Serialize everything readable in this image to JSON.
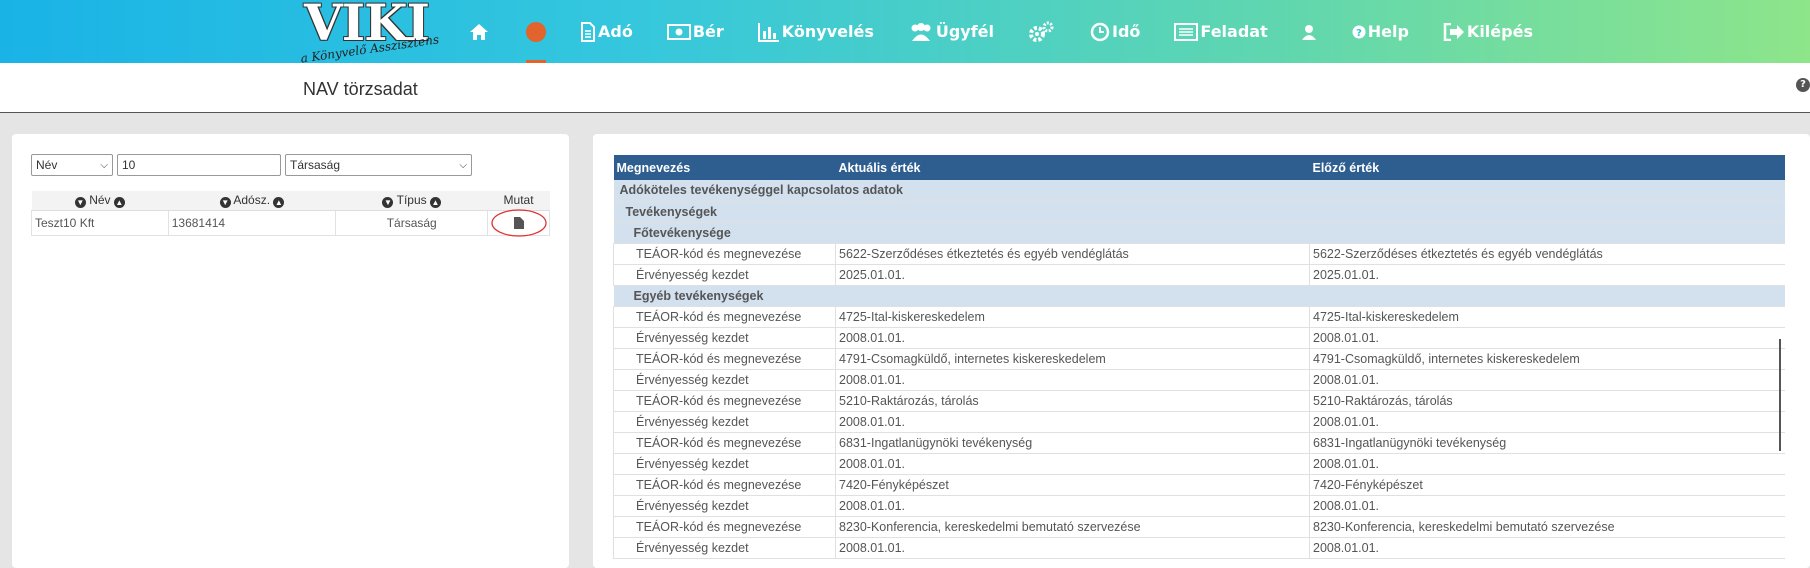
{
  "nav": {
    "logo_title": "VIKI",
    "logo_subtitle": "a Könyvelő Asszisztens",
    "items": [
      {
        "label": "",
        "icon": "home-icon"
      },
      {
        "label": "",
        "icon": "globe-icon"
      },
      {
        "label": "Adó",
        "icon": "document-icon"
      },
      {
        "label": "Bér",
        "icon": "money-icon"
      },
      {
        "label": "Könyvelés",
        "icon": "bar-chart-icon"
      },
      {
        "label": "Ügyfél",
        "icon": "users-icon"
      },
      {
        "label": "",
        "icon": "gears-icon"
      },
      {
        "label": "Idő",
        "icon": "clock-icon"
      },
      {
        "label": "Feladat",
        "icon": "list-icon"
      },
      {
        "label": "",
        "icon": "user-icon"
      },
      {
        "label": "Help",
        "icon": "question-icon"
      },
      {
        "label": "Kilépés",
        "icon": "logout-icon"
      }
    ]
  },
  "page": {
    "title": "NAV törzsadat"
  },
  "filters": {
    "field": "Név",
    "value": "10",
    "type": "Társaság"
  },
  "left_table": {
    "headers": [
      "Név",
      "Adósz.",
      "Típus",
      "Mutat"
    ],
    "rows": [
      {
        "name": "Teszt10 Kft",
        "tax": "13681414",
        "type": "Társaság"
      }
    ]
  },
  "right_table": {
    "headers": [
      "Megnevezés",
      "Aktuális érték",
      "Előző érték"
    ],
    "rows": [
      {
        "kind": "sec",
        "label": "Adóköteles tevékenységgel kapcsolatos adatok",
        "indent": 1
      },
      {
        "kind": "sec",
        "label": "Tevékenységek",
        "indent": 2
      },
      {
        "kind": "sec",
        "label": "Főtevékenysége",
        "indent": 3
      },
      {
        "kind": "row",
        "label": "TEÁOR-kód és megnevezése",
        "cur": "5622-Szerződéses étkeztetés és egyéb vendéglátás",
        "prev": "5622-Szerződéses étkeztetés és egyéb vendéglátás"
      },
      {
        "kind": "row",
        "label": "Érvényesség kezdet",
        "cur": "2025.01.01.",
        "prev": "2025.01.01."
      },
      {
        "kind": "sec",
        "label": "Egyéb tevékenységek",
        "indent": 3
      },
      {
        "kind": "row",
        "label": "TEÁOR-kód és megnevezése",
        "cur": "4725-Ital-kiskereskedelem",
        "prev": "4725-Ital-kiskereskedelem"
      },
      {
        "kind": "row",
        "label": "Érvényesség kezdet",
        "cur": "2008.01.01.",
        "prev": "2008.01.01."
      },
      {
        "kind": "row",
        "label": "TEÁOR-kód és megnevezése",
        "cur": "4791-Csomagküldő, internetes kiskereskedelem",
        "prev": "4791-Csomagküldő, internetes kiskereskedelem"
      },
      {
        "kind": "row",
        "label": "Érvényesség kezdet",
        "cur": "2008.01.01.",
        "prev": "2008.01.01."
      },
      {
        "kind": "row",
        "label": "TEÁOR-kód és megnevezése",
        "cur": "5210-Raktározás, tárolás",
        "prev": "5210-Raktározás, tárolás"
      },
      {
        "kind": "row",
        "label": "Érvényesség kezdet",
        "cur": "2008.01.01.",
        "prev": "2008.01.01."
      },
      {
        "kind": "row",
        "label": "TEÁOR-kód és megnevezése",
        "cur": "6831-Ingatlanügynöki tevékenység",
        "prev": "6831-Ingatlanügynöki tevékenység"
      },
      {
        "kind": "row",
        "label": "Érvényesség kezdet",
        "cur": "2008.01.01.",
        "prev": "2008.01.01."
      },
      {
        "kind": "row",
        "label": "TEÁOR-kód és megnevezése",
        "cur": "7420-Fényképészet",
        "prev": "7420-Fényképészet"
      },
      {
        "kind": "row",
        "label": "Érvényesség kezdet",
        "cur": "2008.01.01.",
        "prev": "2008.01.01."
      },
      {
        "kind": "row",
        "label": "TEÁOR-kód és megnevezése",
        "cur": "8230-Konferencia, kereskedelmi bemutató szervezése",
        "prev": "8230-Konferencia, kereskedelmi bemutató szervezése"
      },
      {
        "kind": "row",
        "label": "Érvényesség kezdet",
        "cur": "2008.01.01.",
        "prev": "2008.01.01."
      }
    ]
  }
}
